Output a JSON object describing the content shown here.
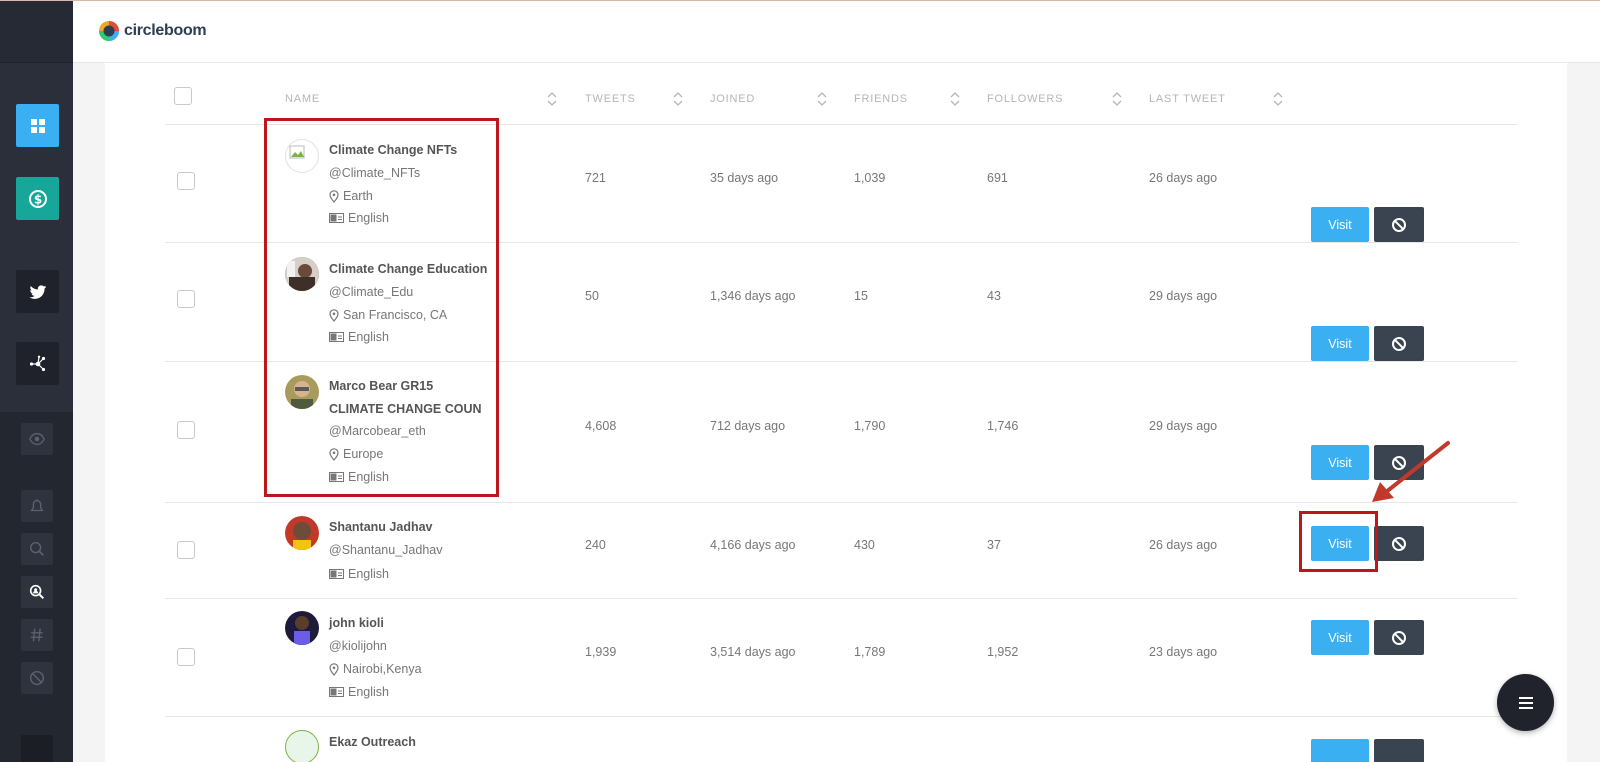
{
  "app": {
    "brand": "circleboom"
  },
  "table": {
    "headers": {
      "name": "NAME",
      "tweets": "TWEETS",
      "joined": "JOINED",
      "friends": "FRIENDS",
      "followers": "FOLLOWERS",
      "last_tweet": "LAST TWEET"
    },
    "rows": [
      {
        "name": "Climate Change NFTs",
        "handle": "@Climate_NFTs",
        "location": "Earth",
        "language": "English",
        "tweets": "721",
        "joined": "35 days ago",
        "friends": "1,039",
        "followers": "691",
        "last_tweet": "26 days ago",
        "visit": "Visit"
      },
      {
        "name": "Climate Change Education",
        "handle": "@Climate_Edu",
        "location": "San Francisco, CA",
        "language": "English",
        "tweets": "50",
        "joined": "1,346 days ago",
        "friends": "15",
        "followers": "43",
        "last_tweet": "29 days ago",
        "visit": "Visit"
      },
      {
        "name": "Marco Bear GR15",
        "name_line2": "CLIMATE CHANGE COUN",
        "handle": "@Marcobear_eth",
        "location": "Europe",
        "language": "English",
        "tweets": "4,608",
        "joined": "712 days ago",
        "friends": "1,790",
        "followers": "1,746",
        "last_tweet": "29 days ago",
        "visit": "Visit"
      },
      {
        "name": "Shantanu Jadhav",
        "handle": "@Shantanu_Jadhav",
        "language": "English",
        "tweets": "240",
        "joined": "4,166 days ago",
        "friends": "430",
        "followers": "37",
        "last_tweet": "26 days ago",
        "visit": "Visit"
      },
      {
        "name": "john kioli",
        "handle": "@kiolijohn",
        "location": "Nairobi,Kenya",
        "language": "English",
        "tweets": "1,939",
        "joined": "3,514 days ago",
        "friends": "1,789",
        "followers": "1,952",
        "last_tweet": "23 days ago",
        "visit": "Visit"
      },
      {
        "name": "Ekaz Outreach"
      }
    ]
  },
  "colors": {
    "sidebar": "#2b2f3a",
    "accent_blue": "#3ab0f2",
    "teal": "#17a79a",
    "block_button": "#3a4350",
    "highlight_red": "#c0161b"
  },
  "icons": {
    "sidebar": [
      "dashboard-icon",
      "dollar-circle-icon",
      "twitter-icon",
      "network-icon",
      "eye-icon",
      "bell-icon",
      "search-icon",
      "search-user-icon",
      "hashtag-icon",
      "block-icon"
    ],
    "fab": "menu-icon"
  }
}
